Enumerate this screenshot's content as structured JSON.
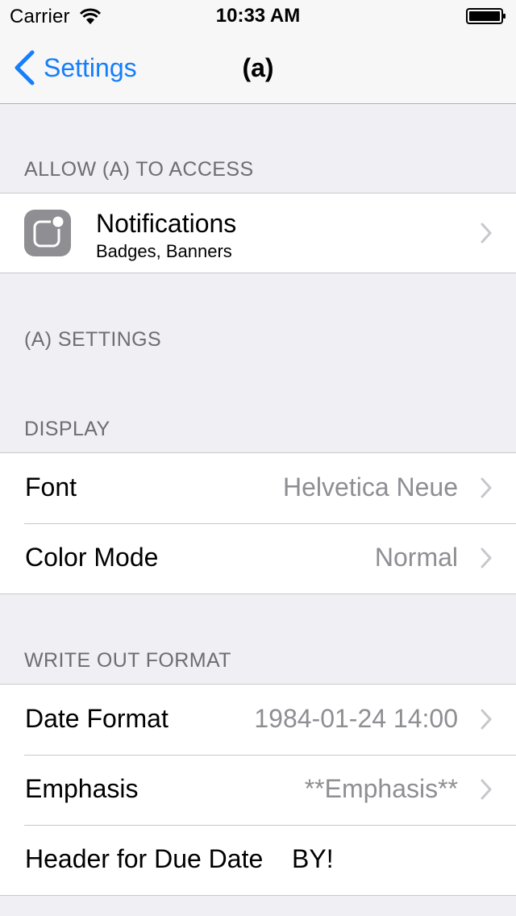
{
  "status_bar": {
    "carrier": "Carrier",
    "time": "10:33 AM",
    "icons": [
      "wifi-icon",
      "battery-icon"
    ]
  },
  "nav": {
    "back_label": "Settings",
    "title": "(a)",
    "accent_color": "#157efb"
  },
  "sections": {
    "allow_access": {
      "header": "ALLOW (A) TO ACCESS",
      "notifications": {
        "title": "Notifications",
        "subtitle": "Badges, Banners",
        "icon": "notifications-icon"
      }
    },
    "app_settings": {
      "header": "(A) SETTINGS"
    },
    "display": {
      "header": "DISPLAY",
      "rows": [
        {
          "label": "Font",
          "value": "Helvetica Neue"
        },
        {
          "label": "Color Mode",
          "value": "Normal"
        }
      ]
    },
    "write_out": {
      "header": "WRITE OUT FORMAT",
      "rows": [
        {
          "label": "Date Format",
          "value": "1984-01-24 14:00"
        },
        {
          "label": "Emphasis",
          "value": "**Emphasis**"
        },
        {
          "label": "Header for Due Date",
          "value": "BY!"
        }
      ]
    }
  }
}
